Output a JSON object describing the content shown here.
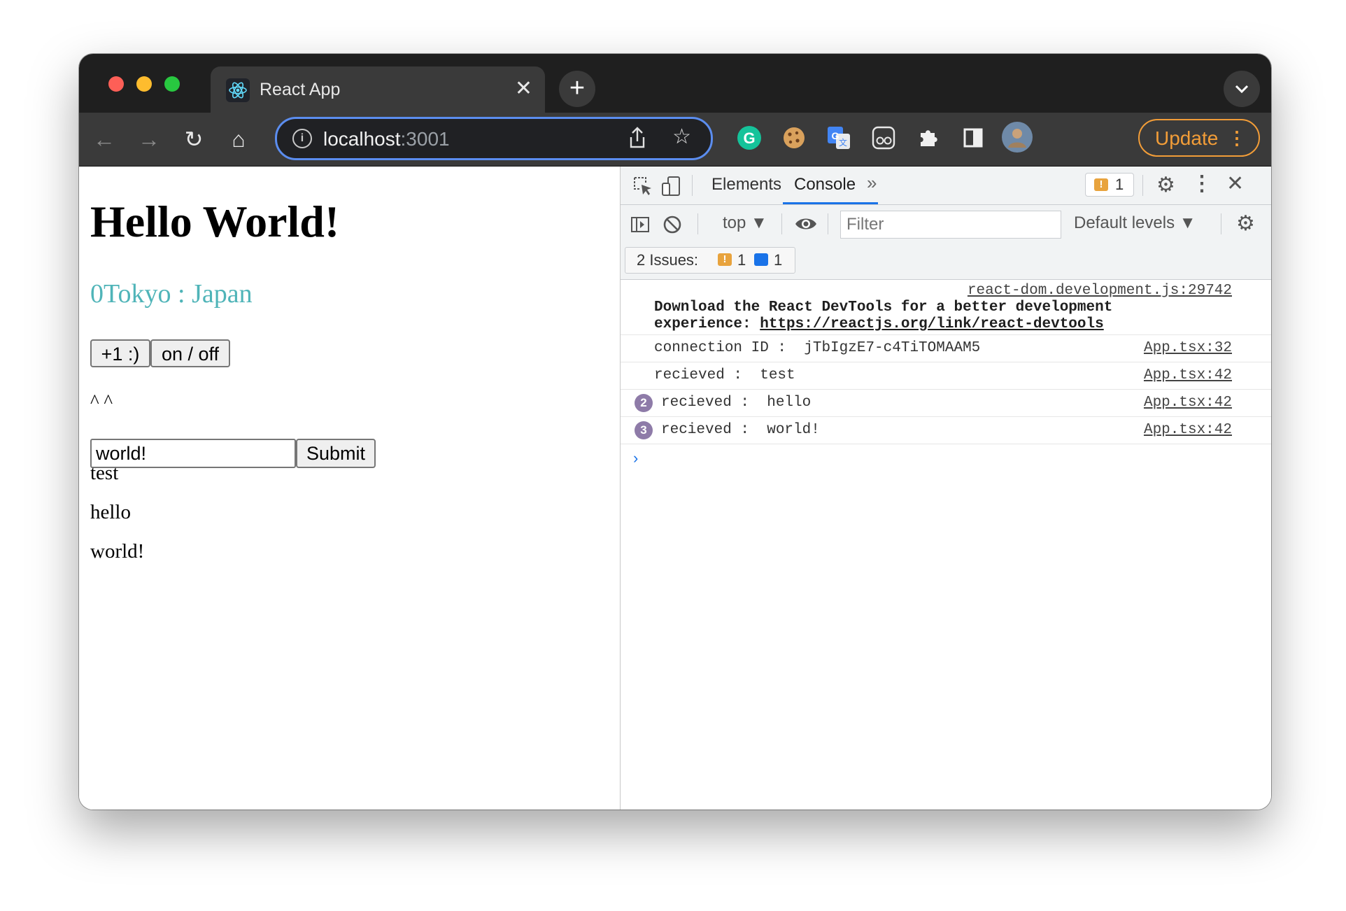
{
  "browser": {
    "tab_title": "React App",
    "tab_close": "✕",
    "new_tab": "+",
    "tab_menu": "⌄",
    "url_host": "localhost",
    "url_port": ":3001",
    "update_label": "Update",
    "update_menu": "⋮",
    "nav": {
      "back": "←",
      "forward": "→",
      "reload": "↻",
      "home": "⌂"
    },
    "icons": [
      "info-icon",
      "share-icon",
      "star-icon",
      "grammarly-extension-icon",
      "cookie-extension-icon",
      "translate-extension-icon",
      "glasses-extension-icon",
      "extensions-puzzle-icon",
      "side-panel-icon",
      "profile-avatar"
    ],
    "colors": {
      "frame": "#1f1f1f",
      "toolbar": "#3a3a3a",
      "omnibox_border": "#5b8def",
      "update": "#f29d38"
    }
  },
  "page": {
    "heading": "Hello World!",
    "location": "0Tokyo : Japan",
    "increment_button": "+1 :)",
    "toggle_button": "on / off",
    "caret_text": "^ ^",
    "input_value": "world!",
    "submit_button": "Submit",
    "messages": [
      "test",
      "hello",
      "world!"
    ],
    "colors": {
      "location": "#4fb4b8"
    }
  },
  "devtools": {
    "tabs": [
      "Elements",
      "Console"
    ],
    "active_tab": "Console",
    "more_tabs": "»",
    "issue_badge_count": "1",
    "console_toolbar": {
      "context": "top ▼",
      "filter_placeholder": "Filter",
      "levels": "Default levels ▼"
    },
    "issues": {
      "label": "2 Issues:",
      "warning_count": "1",
      "info_count": "1"
    },
    "logs": [
      {
        "source": "react-dom.development.js:29742",
        "line1": "Download the React DevTools for a better development",
        "line2_prefix": "experience: ",
        "link": "https://reactjs.org/link/react-devtools"
      },
      {
        "text": "connection ID :  jTbIgzE7-c4TiTOMAAM5",
        "source": "App.tsx:32"
      },
      {
        "text": "recieved :  test",
        "source": "App.tsx:42"
      },
      {
        "count": "2",
        "text": "recieved :  hello",
        "source": "App.tsx:42"
      },
      {
        "count": "3",
        "text": "recieved :  world!",
        "source": "App.tsx:42"
      }
    ],
    "prompt": "›"
  }
}
